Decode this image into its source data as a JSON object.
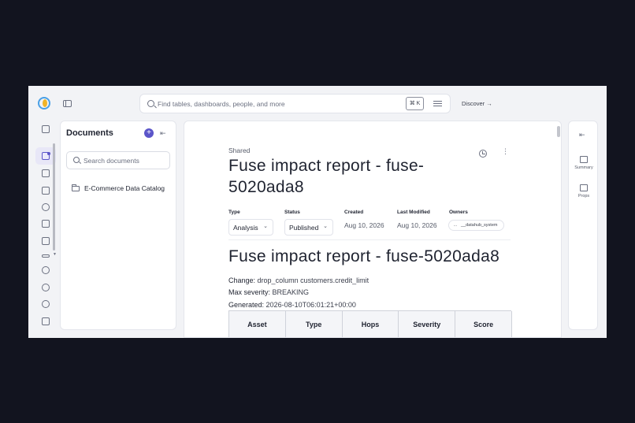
{
  "topbar": {
    "search_placeholder": "Find tables, dashboards, people, and more",
    "search_shortcut": "⌘ K",
    "discover_label": "Discover →"
  },
  "documents_panel": {
    "title": "Documents",
    "add_label": "+",
    "collapse_label": "⇤",
    "search_placeholder": "Search documents",
    "folders": [
      {
        "label": "E-Commerce Data Catalog"
      }
    ]
  },
  "document": {
    "breadcrumb": "Shared",
    "more_label": "⋮",
    "title": "Fuse impact report - fuse-5020ada8",
    "properties": {
      "type": {
        "label": "Type",
        "value": "Analysis"
      },
      "status": {
        "label": "Status",
        "value": "Published"
      },
      "created": {
        "label": "Created",
        "value": "Aug 10, 2026"
      },
      "last_modified": {
        "label": "Last Modified",
        "value": "Aug 10, 2026"
      },
      "owners": {
        "label": "Owners",
        "avatar": "...",
        "value": "__datahub_system"
      }
    },
    "body": {
      "heading": "Fuse impact report - fuse-5020ada8",
      "change_label": "Change:",
      "change_value": "drop_column customers.credit_limit",
      "severity_label": "Max severity:",
      "severity_value": "BREAKING",
      "generated_label": "Generated:",
      "generated_value": "2026-08-10T06:01:21+00:00",
      "table_headers": [
        "Asset",
        "Type",
        "Hops",
        "Severity",
        "Score"
      ]
    }
  },
  "right_rail": {
    "collapse_label": "⇤",
    "items": [
      {
        "label": "Summary"
      },
      {
        "label": "Props"
      }
    ]
  },
  "colors": {
    "accent": "#5b55c9",
    "background": "#12141f",
    "app_background": "#f2f3f6"
  }
}
